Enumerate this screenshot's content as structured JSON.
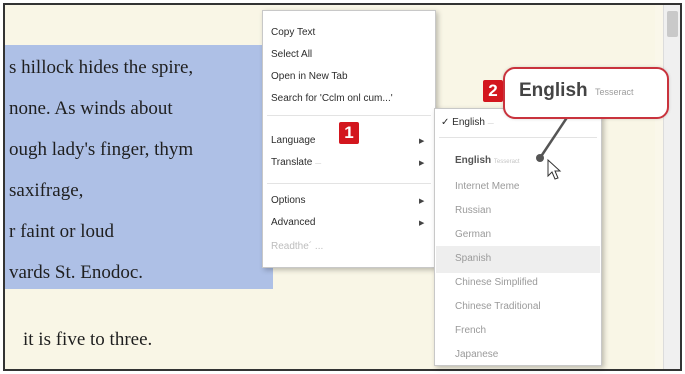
{
  "document": {
    "lines": [
      "s hillock hides the spire,",
      "none. As winds about",
      "ough lady's finger, thym",
      "saxifrage,",
      "r faint or loud",
      "vards St. Enodoc.",
      "it is five to three."
    ]
  },
  "context_menu": {
    "copy_text": "Copy Text",
    "select_all": "Select All",
    "open_new_tab": "Open in New Tab",
    "search_for": "Search for 'Cclm onl cum...'",
    "language": "Language",
    "translate": "Translate",
    "translate_hint": "—",
    "options": "Options",
    "advanced": "Advanced",
    "disabled_item": "Readthe´ ..."
  },
  "language_menu": {
    "checkmark": "✓",
    "current": "English",
    "current_hint": "—",
    "items": [
      "English",
      "Internet Meme",
      "Russian",
      "German",
      "Spanish",
      "Chinese Simplified",
      "Chinese Traditional",
      "French",
      "Japanese"
    ],
    "tesseract_tag": "Tesseract"
  },
  "annotations": {
    "badge1": "1",
    "badge2": "2",
    "callout_language": "English",
    "callout_engine": "Tesseract",
    "accent_color": "#d3161e"
  }
}
